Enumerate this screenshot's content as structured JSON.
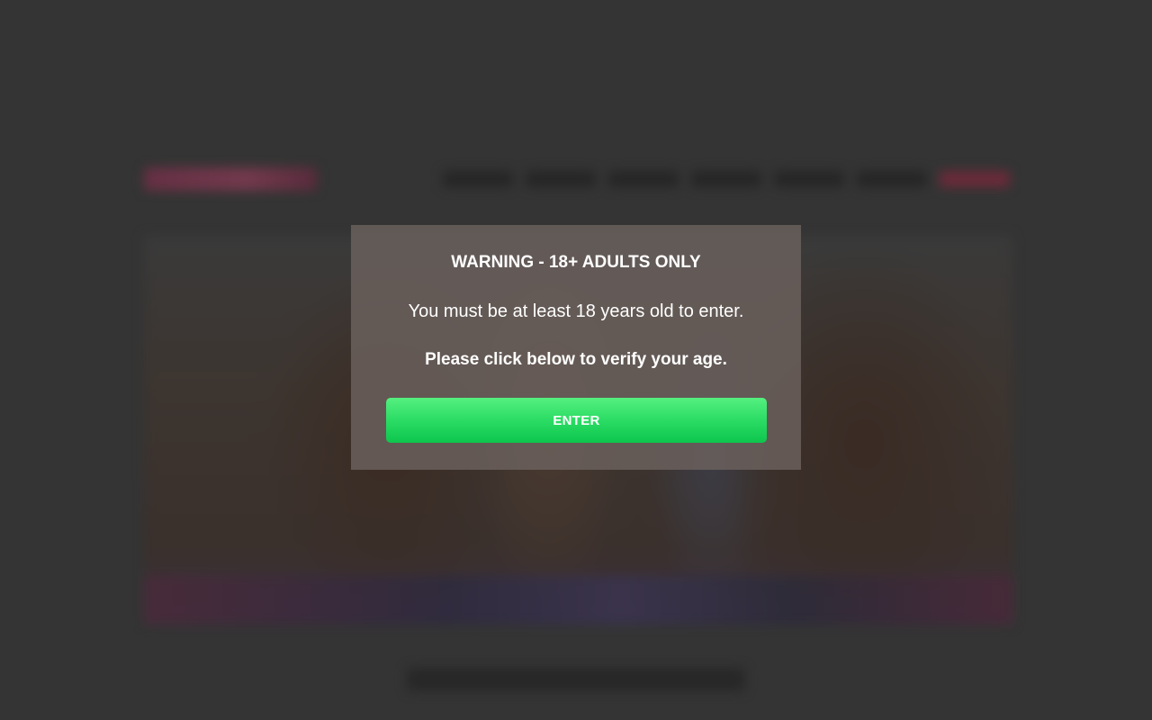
{
  "modal": {
    "title": "WARNING - 18+ ADULTS ONLY",
    "message": "You must be at least 18 years old to enter.",
    "verify_text": "Please click below to verify your age.",
    "enter_label": "ENTER"
  },
  "colors": {
    "overlay": "#343434",
    "modal_bg": "#6e6460",
    "button_green_top": "#55f07f",
    "button_green_bottom": "#0dc64d",
    "text": "#ffffff"
  }
}
